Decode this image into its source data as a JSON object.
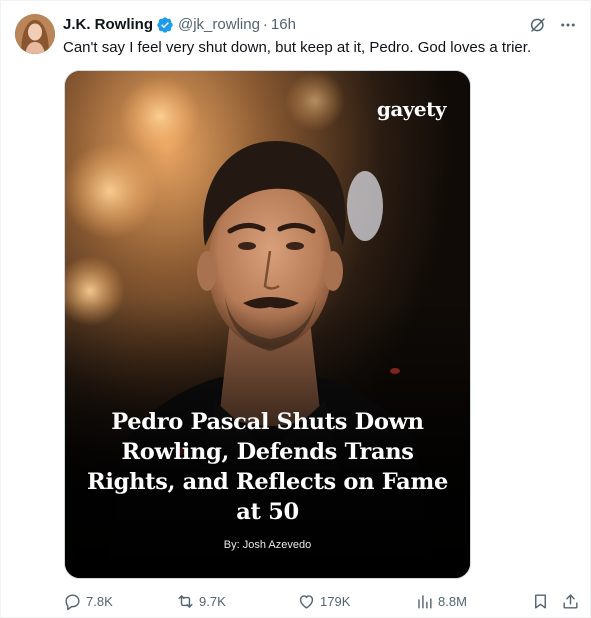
{
  "tweet": {
    "author": {
      "display_name": "J.K. Rowling",
      "handle": "@jk_rowling",
      "verified": true,
      "avatar": "author-avatar"
    },
    "separator": "·",
    "time": "16h",
    "text": "Can't say I feel very shut down, but keep at it, Pedro. God loves a trier.",
    "top_icons": [
      "grok-icon",
      "more-icon"
    ],
    "media": {
      "brand": "gayety",
      "headline": "Pedro Pascal Shuts Down Rowling, Defends Trans Rights, and Reflects on Fame at 50",
      "byline": "By: Josh Azevedo"
    },
    "stats": {
      "replies": "7.8K",
      "reposts": "9.7K",
      "likes": "179K",
      "views": "8.8M"
    }
  },
  "colors": {
    "text_primary": "#0f1419",
    "text_secondary": "#536471",
    "verified_blue": "#1d9bf0",
    "border": "#cfd9de"
  }
}
